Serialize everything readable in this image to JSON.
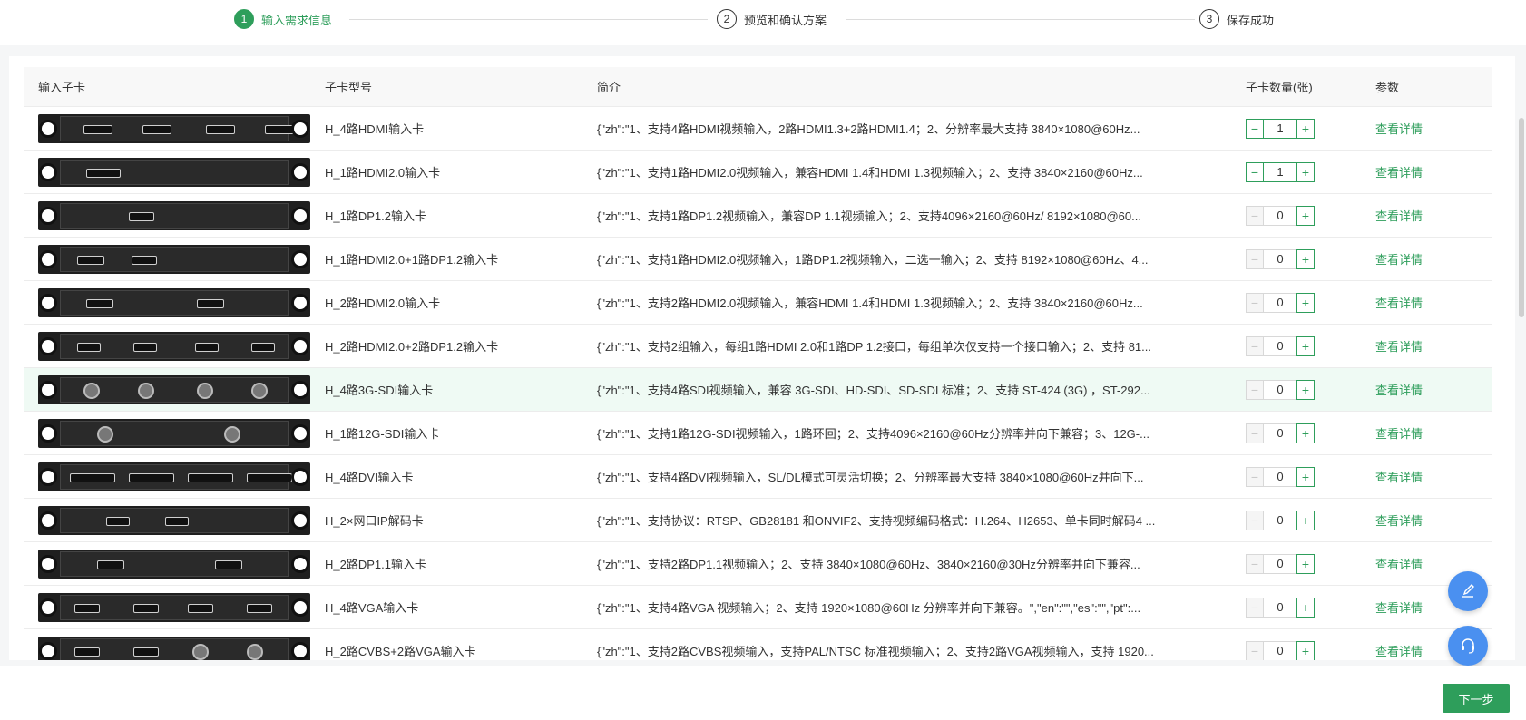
{
  "steps": [
    {
      "num": "1",
      "label": "输入需求信息",
      "active": true
    },
    {
      "num": "2",
      "label": "预览和确认方案",
      "active": false
    },
    {
      "num": "3",
      "label": "保存成功",
      "active": false
    }
  ],
  "table": {
    "headers": {
      "card": "输入子卡",
      "model": "子卡型号",
      "desc": "简介",
      "qty": "子卡数量(张)",
      "params": "参数"
    },
    "rows": [
      {
        "model": "H_4路HDMI输入卡",
        "desc": "{\"zh\":\"1、支持4路HDMI视频输入，2路HDMI1.3+2路HDMI1.4；2、分辨率最大支持 3840×1080@60Hz...",
        "qty": "1",
        "link": "查看详情",
        "ports": "hdmi4"
      },
      {
        "model": "H_1路HDMI2.0输入卡",
        "desc": "{\"zh\":\"1、支持1路HDMI2.0视频输入，兼容HDMI 1.4和HDMI 1.3视频输入；2、支持 3840×2160@60Hz...",
        "qty": "1",
        "link": "查看详情",
        "ports": "hdmi1"
      },
      {
        "model": "H_1路DP1.2输入卡",
        "desc": "{\"zh\":\"1、支持1路DP1.2视频输入，兼容DP 1.1视频输入；2、支持4096×2160@60Hz/ 8192×1080@60...",
        "qty": "0",
        "link": "查看详情",
        "ports": "dp1"
      },
      {
        "model": "H_1路HDMI2.0+1路DP1.2输入卡",
        "desc": "{\"zh\":\"1、支持1路HDMI2.0视频输入，1路DP1.2视频输入，二选一输入；2、支持 8192×1080@60Hz、4...",
        "qty": "0",
        "link": "查看详情",
        "ports": "hdmi-dp"
      },
      {
        "model": "H_2路HDMI2.0输入卡",
        "desc": "{\"zh\":\"1、支持2路HDMI2.0视频输入，兼容HDMI 1.4和HDMI 1.3视频输入；2、支持 3840×2160@60Hz...",
        "qty": "0",
        "link": "查看详情",
        "ports": "hdmi2"
      },
      {
        "model": "H_2路HDMI2.0+2路DP1.2输入卡",
        "desc": "{\"zh\":\"1、支持2组输入，每组1路HDMI 2.0和1路DP 1.2接口，每组单次仅支持一个接口输入；2、支持 81...",
        "qty": "0",
        "link": "查看详情",
        "ports": "hdmi2-dp2"
      },
      {
        "model": "H_4路3G-SDI输入卡",
        "desc": "{\"zh\":\"1、支持4路SDI视频输入，兼容 3G-SDI、HD-SDI、SD-SDI 标准；2、支持 ST-424 (3G) ，ST-292...",
        "qty": "0",
        "link": "查看详情",
        "ports": "sdi4",
        "highlight": true
      },
      {
        "model": "H_1路12G-SDI输入卡",
        "desc": "{\"zh\":\"1、支持1路12G-SDI视频输入，1路环回；2、支持4096×2160@60Hz分辨率并向下兼容；3、12G-...",
        "qty": "0",
        "link": "查看详情",
        "ports": "sdi12"
      },
      {
        "model": "H_4路DVI输入卡",
        "desc": "{\"zh\":\"1、支持4路DVI视频输入，SL/DL模式可灵活切换；2、分辨率最大支持 3840×1080@60Hz并向下...",
        "qty": "0",
        "link": "查看详情",
        "ports": "dvi4"
      },
      {
        "model": "H_2×网口IP解码卡",
        "desc": "{\"zh\":\"1、支持协议：RTSP、GB28181 和ONVIF2、支持视频编码格式：H.264、H2653、单卡同时解码4 ...",
        "qty": "0",
        "link": "查看详情",
        "ports": "eth2"
      },
      {
        "model": "H_2路DP1.1输入卡",
        "desc": "{\"zh\":\"1、支持2路DP1.1视频输入；2、支持 3840×1080@60Hz、3840×2160@30Hz分辨率并向下兼容...",
        "qty": "0",
        "link": "查看详情",
        "ports": "dp2"
      },
      {
        "model": "H_4路VGA输入卡",
        "desc": "{\"zh\":\"1、支持4路VGA 视频输入；2、支持 1920×1080@60Hz 分辨率并向下兼容。\",\"en\":\"\",\"es\":\"\",\"pt\":...",
        "qty": "0",
        "link": "查看详情",
        "ports": "vga4"
      },
      {
        "model": "H_2路CVBS+2路VGA输入卡",
        "desc": "{\"zh\":\"1、支持2路CVBS视频输入，支持PAL/NTSC 标准视频输入；2、支持2路VGA视频输入，支持 1920...",
        "qty": "0",
        "link": "查看详情",
        "ports": "cvbs-vga"
      }
    ]
  },
  "footer": {
    "next_label": "下一步"
  },
  "fabs": [
    {
      "icon": "edit-icon"
    },
    {
      "icon": "headset-icon"
    }
  ],
  "colors": {
    "accent": "#2e9e5b",
    "fab": "#4a90f0"
  }
}
